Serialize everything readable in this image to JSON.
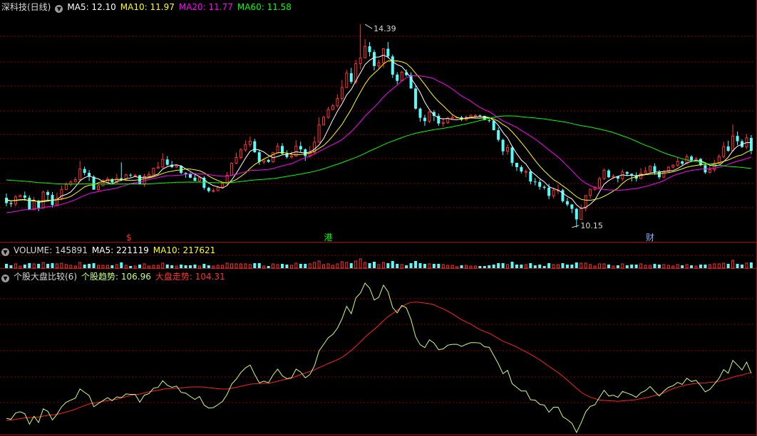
{
  "colors": {
    "background": "#000000",
    "grid": "#8b0000",
    "up": "#ff3232",
    "down": "#54fcfc",
    "ma5": "#ffffff",
    "ma10": "#ffff00",
    "ma20": "#ff00ff",
    "ma60": "#00ff00",
    "stock_trend": "#c8ff78",
    "market_trend": "#ff2020"
  },
  "header_main": {
    "title": "深科技(日线)",
    "toggle_icon": "chevron-down-icon",
    "ma5": "MA5: 12.10",
    "ma10": "MA10: 11.97",
    "ma20": "MA20: 11.77",
    "ma60": "MA60: 11.58"
  },
  "header_volume": {
    "volume": "VOLUME: 145891",
    "ma5": "MA5: 221119",
    "ma10": "MA10: 217621"
  },
  "header_compare": {
    "name": "个股大盘比较(6)",
    "stock_trend": "个股趋势: 106.96",
    "market_trend": "大盘走势: 104.31"
  },
  "markers": [
    {
      "text": "$",
      "color": "#ff3232",
      "bar": 27
    },
    {
      "text": "港",
      "color": "#00ff00",
      "bar": 70
    },
    {
      "text": "财",
      "color": "#7fb2ff",
      "bar": 140
    }
  ],
  "chart_data": {
    "type": "candlestick",
    "annotations": [
      {
        "text": "14.39",
        "bar": 78,
        "value": 14.39,
        "kind": "high"
      },
      {
        "text": "10.15",
        "bar": 123,
        "value": 10.15,
        "kind": "low"
      }
    ],
    "price_range": [
      10.0,
      14.6
    ],
    "grid": true,
    "series": [
      {
        "name": "MA5",
        "values": []
      },
      {
        "name": "MA10",
        "values": []
      },
      {
        "name": "MA20",
        "values": []
      },
      {
        "name": "MA60",
        "values": []
      }
    ],
    "candles": [
      [
        10.77,
        10.66,
        10.86,
        10.59
      ],
      [
        10.66,
        10.64,
        10.7,
        10.58
      ],
      [
        10.64,
        10.79,
        10.83,
        10.59
      ],
      [
        10.79,
        10.82,
        10.84,
        10.78
      ],
      [
        10.82,
        10.77,
        10.9,
        10.71
      ],
      [
        10.77,
        10.52,
        10.82,
        10.52
      ],
      [
        10.52,
        10.71,
        10.79,
        10.52
      ],
      [
        10.71,
        10.56,
        10.73,
        10.49
      ],
      [
        10.56,
        10.89,
        10.92,
        10.54
      ],
      [
        10.89,
        10.83,
        10.93,
        10.7
      ],
      [
        10.83,
        10.62,
        10.89,
        10.57
      ],
      [
        10.62,
        10.76,
        10.88,
        10.6
      ],
      [
        10.76,
        10.94,
        11.03,
        10.72
      ],
      [
        10.94,
        11.05,
        11.1,
        10.94
      ],
      [
        11.05,
        11.1,
        11.13,
        11.01
      ],
      [
        11.1,
        11.15,
        11.2,
        11.12
      ],
      [
        11.15,
        11.37,
        11.54,
        11.13
      ],
      [
        11.37,
        11.29,
        11.42,
        11.24
      ],
      [
        11.29,
        11.21,
        11.35,
        11.12
      ],
      [
        11.21,
        10.94,
        11.24,
        10.94
      ],
      [
        10.94,
        11.02,
        11.05,
        10.91
      ],
      [
        11.02,
        11.09,
        11.16,
        11.05
      ],
      [
        11.09,
        11.16,
        11.21,
        11.08
      ],
      [
        11.16,
        11.09,
        11.18,
        11.05
      ],
      [
        11.09,
        11.18,
        11.27,
        11.07
      ],
      [
        11.18,
        11.16,
        11.51,
        11.12
      ],
      [
        11.16,
        11.25,
        11.27,
        11.12
      ],
      [
        11.25,
        11.24,
        11.28,
        11.2
      ],
      [
        11.24,
        11.24,
        11.27,
        11.22
      ],
      [
        11.24,
        11.05,
        11.25,
        11.05
      ],
      [
        11.05,
        11.22,
        11.27,
        11.0
      ],
      [
        11.22,
        11.26,
        11.32,
        11.26
      ],
      [
        11.26,
        11.39,
        11.39,
        11.26
      ],
      [
        11.39,
        11.41,
        11.52,
        11.39
      ],
      [
        11.41,
        11.57,
        11.7,
        11.39
      ],
      [
        11.57,
        11.46,
        11.64,
        11.44
      ],
      [
        11.46,
        11.41,
        11.54,
        11.39
      ],
      [
        11.41,
        11.44,
        11.47,
        11.39
      ],
      [
        11.44,
        11.29,
        11.45,
        11.26
      ],
      [
        11.29,
        11.27,
        11.3,
        11.19
      ],
      [
        11.27,
        11.19,
        11.3,
        11.18
      ],
      [
        11.19,
        11.12,
        11.29,
        11.12
      ],
      [
        11.12,
        11.19,
        11.21,
        11.12
      ],
      [
        11.19,
        10.98,
        11.22,
        10.94
      ],
      [
        10.98,
        10.91,
        11.0,
        10.88
      ],
      [
        10.91,
        10.92,
        10.97,
        10.88
      ],
      [
        10.92,
        10.99,
        11.02,
        10.91
      ],
      [
        10.99,
        11.07,
        11.09,
        10.96
      ],
      [
        11.07,
        11.24,
        11.31,
        11.02
      ],
      [
        11.24,
        11.49,
        11.51,
        11.23
      ],
      [
        11.49,
        11.61,
        11.71,
        11.47
      ],
      [
        11.61,
        11.77,
        11.81,
        11.57
      ],
      [
        11.77,
        11.88,
        11.97,
        11.73
      ],
      [
        11.88,
        11.95,
        12.05,
        11.83
      ],
      [
        11.95,
        11.72,
        12.0,
        11.71
      ],
      [
        11.72,
        11.52,
        11.77,
        11.46
      ],
      [
        11.52,
        11.56,
        11.56,
        11.47
      ],
      [
        11.56,
        11.52,
        11.58,
        11.5
      ],
      [
        11.52,
        11.71,
        11.73,
        11.5
      ],
      [
        11.71,
        11.85,
        11.91,
        11.71
      ],
      [
        11.85,
        11.69,
        11.91,
        11.66
      ],
      [
        11.69,
        11.62,
        11.76,
        11.59
      ],
      [
        11.62,
        11.64,
        11.74,
        11.59
      ],
      [
        11.64,
        11.85,
        11.97,
        11.63
      ],
      [
        11.85,
        11.78,
        11.94,
        11.71
      ],
      [
        11.78,
        11.64,
        11.8,
        11.54
      ],
      [
        11.64,
        11.72,
        11.85,
        11.61
      ],
      [
        11.72,
        11.93,
        12.05,
        11.67
      ],
      [
        11.93,
        12.29,
        12.45,
        11.92
      ],
      [
        12.29,
        12.45,
        12.48,
        12.28
      ],
      [
        12.45,
        12.61,
        12.67,
        12.42
      ],
      [
        12.61,
        12.69,
        12.73,
        12.61
      ],
      [
        12.69,
        12.84,
        12.93,
        12.65
      ],
      [
        12.84,
        13.07,
        13.23,
        12.78
      ],
      [
        13.07,
        13.37,
        13.44,
        13.06
      ],
      [
        13.37,
        13.19,
        13.48,
        13.15
      ],
      [
        13.19,
        13.57,
        13.65,
        13.14
      ],
      [
        13.57,
        13.69,
        14.39,
        13.45
      ],
      [
        13.69,
        13.93,
        14.08,
        13.69
      ],
      [
        13.93,
        13.81,
        14.02,
        13.72
      ],
      [
        13.81,
        13.52,
        13.86,
        13.43
      ],
      [
        13.52,
        13.59,
        13.65,
        13.47
      ],
      [
        13.59,
        13.88,
        13.89,
        13.48
      ],
      [
        13.88,
        13.72,
        14.02,
        13.68
      ],
      [
        13.72,
        13.34,
        13.76,
        13.27
      ],
      [
        13.34,
        13.21,
        13.39,
        13.14
      ],
      [
        13.21,
        13.39,
        13.42,
        13.21
      ],
      [
        13.39,
        13.33,
        13.45,
        13.3
      ],
      [
        13.33,
        13.05,
        13.39,
        13.05
      ],
      [
        13.05,
        12.63,
        13.12,
        12.61
      ],
      [
        12.63,
        12.44,
        12.65,
        12.36
      ],
      [
        12.44,
        12.37,
        12.5,
        12.27
      ],
      [
        12.37,
        12.56,
        12.58,
        12.33
      ],
      [
        12.56,
        12.48,
        12.6,
        12.37
      ],
      [
        12.48,
        12.32,
        12.53,
        12.27
      ],
      [
        12.32,
        12.34,
        12.44,
        12.25
      ],
      [
        12.34,
        12.43,
        12.46,
        12.31
      ],
      [
        12.43,
        12.45,
        12.51,
        12.41
      ],
      [
        12.45,
        12.45,
        12.46,
        12.43
      ],
      [
        12.45,
        12.4,
        12.48,
        12.37
      ],
      [
        12.4,
        12.45,
        12.49,
        12.38
      ],
      [
        12.45,
        12.49,
        12.51,
        12.44
      ],
      [
        12.49,
        12.49,
        12.52,
        12.44
      ],
      [
        12.49,
        12.48,
        12.51,
        12.46
      ],
      [
        12.48,
        12.39,
        12.48,
        12.39
      ],
      [
        12.39,
        12.38,
        12.45,
        12.34
      ],
      [
        12.38,
        12.18,
        12.39,
        12.18
      ],
      [
        12.18,
        11.98,
        12.24,
        11.94
      ],
      [
        11.98,
        11.74,
        12.0,
        11.66
      ],
      [
        11.74,
        11.82,
        11.89,
        11.67
      ],
      [
        11.82,
        11.5,
        11.85,
        11.43
      ],
      [
        11.5,
        11.41,
        11.5,
        11.33
      ],
      [
        11.41,
        11.32,
        11.45,
        11.28
      ],
      [
        11.32,
        11.32,
        11.36,
        11.2
      ],
      [
        11.32,
        11.11,
        11.36,
        11.05
      ],
      [
        11.11,
        11.1,
        11.18,
        11.03
      ],
      [
        11.1,
        11.0,
        11.15,
        10.94
      ],
      [
        11.0,
        10.98,
        11.03,
        10.94
      ],
      [
        10.98,
        10.81,
        11.06,
        10.74
      ],
      [
        10.81,
        10.93,
        10.98,
        10.76
      ],
      [
        10.93,
        10.93,
        11.05,
        10.85
      ],
      [
        10.93,
        10.7,
        10.96,
        10.67
      ],
      [
        10.7,
        10.63,
        10.77,
        10.59
      ],
      [
        10.63,
        10.54,
        10.64,
        10.45
      ],
      [
        10.54,
        10.32,
        10.56,
        10.15
      ],
      [
        10.32,
        10.55,
        10.63,
        10.32
      ],
      [
        10.55,
        10.82,
        10.82,
        10.49
      ],
      [
        10.82,
        10.95,
        10.95,
        10.75
      ],
      [
        10.95,
        10.99,
        11.01,
        10.92
      ],
      [
        10.99,
        11.17,
        11.21,
        10.95
      ],
      [
        11.17,
        11.34,
        11.38,
        11.14
      ],
      [
        11.34,
        11.2,
        11.37,
        11.18
      ],
      [
        11.2,
        11.22,
        11.26,
        11.17
      ],
      [
        11.22,
        11.17,
        11.21,
        11.09
      ],
      [
        11.17,
        11.31,
        11.37,
        11.12
      ],
      [
        11.31,
        11.27,
        11.32,
        11.22
      ],
      [
        11.27,
        11.23,
        11.28,
        11.11
      ],
      [
        11.23,
        11.17,
        11.3,
        11.11
      ],
      [
        11.17,
        11.28,
        11.39,
        11.16
      ],
      [
        11.28,
        11.33,
        11.41,
        11.26
      ],
      [
        11.33,
        11.43,
        11.44,
        11.3
      ],
      [
        11.43,
        11.31,
        11.49,
        11.25
      ],
      [
        11.31,
        11.2,
        11.35,
        11.16
      ],
      [
        11.2,
        11.32,
        11.35,
        11.18
      ],
      [
        11.32,
        11.41,
        11.43,
        11.3
      ],
      [
        11.41,
        11.45,
        11.47,
        11.38
      ],
      [
        11.45,
        11.53,
        11.61,
        11.42
      ],
      [
        11.53,
        11.48,
        11.55,
        11.45
      ],
      [
        11.48,
        11.63,
        11.68,
        11.47
      ],
      [
        11.63,
        11.55,
        11.66,
        11.52
      ],
      [
        11.55,
        11.58,
        11.62,
        11.54
      ],
      [
        11.58,
        11.45,
        11.6,
        11.43
      ],
      [
        11.45,
        11.3,
        11.47,
        11.27
      ],
      [
        11.3,
        11.36,
        11.44,
        11.28
      ],
      [
        11.36,
        11.49,
        11.56,
        11.31
      ],
      [
        11.49,
        11.63,
        11.68,
        11.45
      ],
      [
        11.63,
        11.84,
        11.94,
        11.6
      ],
      [
        11.84,
        11.75,
        11.96,
        11.73
      ],
      [
        11.75,
        12.06,
        12.3,
        11.74
      ],
      [
        12.06,
        11.95,
        12.15,
        11.87
      ],
      [
        11.95,
        11.83,
        11.99,
        11.81
      ],
      [
        11.83,
        12.02,
        12.1,
        11.79
      ],
      [
        12.02,
        11.75,
        12.08,
        11.68
      ]
    ]
  }
}
